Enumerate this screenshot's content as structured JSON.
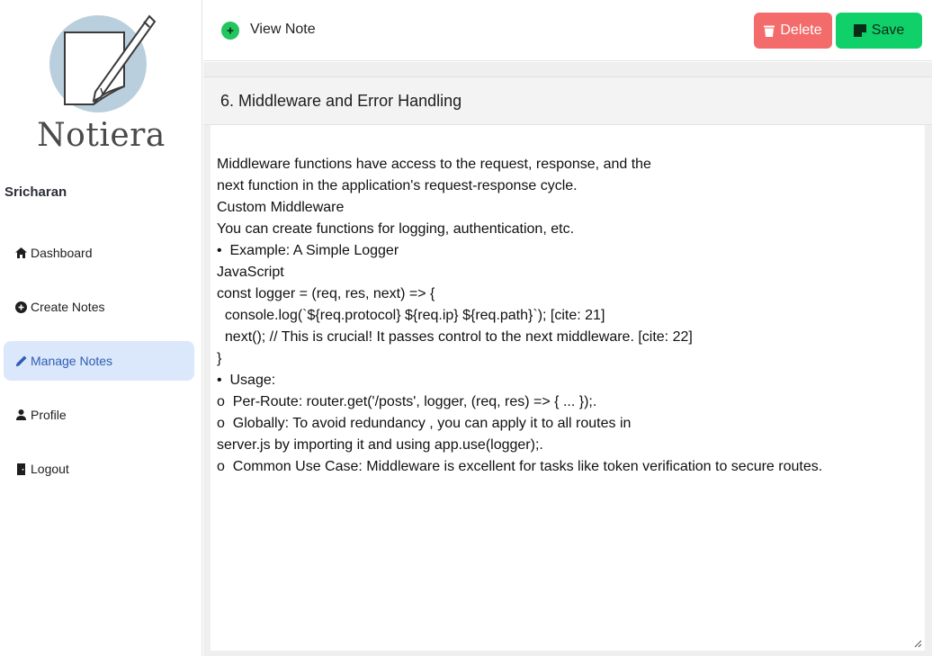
{
  "sidebar": {
    "brand": "Notiera",
    "user_name": "Sricharan",
    "items": [
      {
        "label": "Dashboard",
        "icon": "home-icon"
      },
      {
        "label": "Create Notes",
        "icon": "plus-circle-icon"
      },
      {
        "label": "Manage Notes",
        "icon": "pencil-icon",
        "active": true
      },
      {
        "label": "Profile",
        "icon": "user-icon"
      },
      {
        "label": "Logout",
        "icon": "door-icon"
      }
    ]
  },
  "header": {
    "title": "View Note",
    "delete_label": "Delete",
    "save_label": "Save"
  },
  "note": {
    "title": "6. Middleware and Error Handling",
    "lines": [
      "Middleware functions have access to the request, response, and the",
      "next function in the application's request-response cycle.",
      "Custom Middleware",
      "You can create functions for logging, authentication, etc.",
      "•  Example: A Simple Logger",
      "JavaScript",
      "const logger = (req, res, next) => {",
      "  console.log(`${req.protocol} ${req.ip} ${req.path}`); [cite: 21]",
      "  next(); // This is crucial! It passes control to the next middleware. [cite: 22]",
      "}",
      "•  Usage:",
      "o  Per-Route: router.get('/posts', logger, (req, res) => { ... });.",
      "o  Globally: To avoid redundancy , you can apply it to all routes in",
      "server.js by importing it and using app.use(logger);.",
      "o  Common Use Case: Middleware is excellent for tasks like token verification to secure routes."
    ]
  },
  "colors": {
    "delete": "#f36b6b",
    "save": "#10d06a",
    "active_nav_bg": "#dbe7fb",
    "active_nav_text": "#2f5db3",
    "view_icon": "#22c55e"
  }
}
